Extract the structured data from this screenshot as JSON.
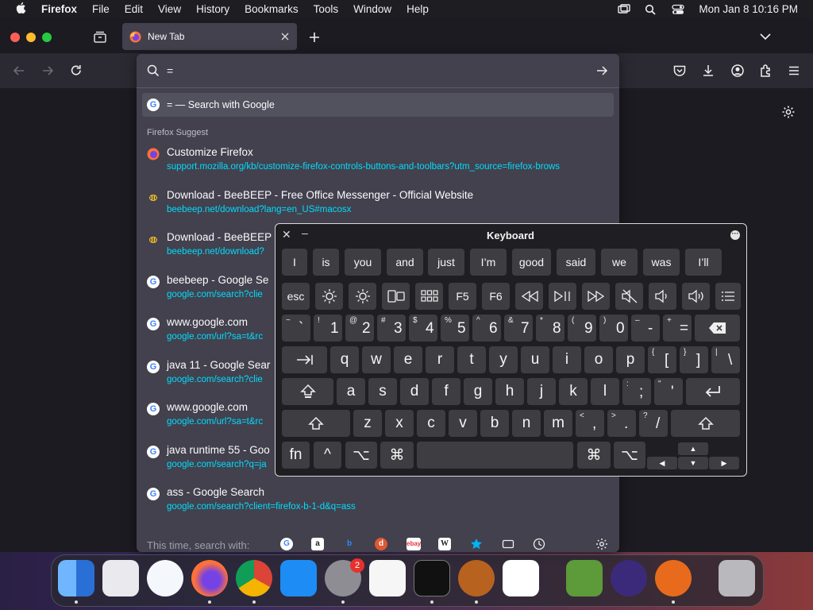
{
  "menubar": {
    "app": "Firefox",
    "items": [
      "File",
      "Edit",
      "View",
      "History",
      "Bookmarks",
      "Tools",
      "Window",
      "Help"
    ],
    "clock": "Mon Jan 8  10:16 PM"
  },
  "browser": {
    "tab_title": "New Tab",
    "url_value": "=",
    "google_search_label": "= — Search with Google",
    "suggest_header": "Firefox Suggest",
    "results": [
      {
        "title": "Customize Firefox",
        "url": "support.mozilla.org/kb/customize-firefox-controls-buttons-and-toolbars?utm_source=firefox-brows",
        "icon": "firefox-icon"
      },
      {
        "title": "Download - BeeBEEP - Free Office Messenger - Official Website",
        "url": "beebeep.net/download?lang=en_US#macosx",
        "icon": "bee-icon"
      },
      {
        "title": "Download - BeeBEEP",
        "url": "beebeep.net/download?",
        "icon": "bee-icon"
      },
      {
        "title": "beebeep - Google Se",
        "url": "google.com/search?clie",
        "icon": "google-icon"
      },
      {
        "title": "www.google.com",
        "url": "google.com/url?sa=t&rc",
        "icon": "google-icon"
      },
      {
        "title": "java 11 - Google Sear",
        "url": "google.com/search?clie",
        "icon": "google-icon"
      },
      {
        "title": "www.google.com",
        "url": "google.com/url?sa=t&rc",
        "icon": "google-icon"
      },
      {
        "title": "java runtime 55 - Goo",
        "url": "google.com/search?q=ja",
        "icon": "google-icon"
      },
      {
        "title": "ass - Google Search",
        "url": "google.com/search?client=firefox-b-1-d&q=ass",
        "icon": "google-icon"
      }
    ],
    "engines_label": "This time, search with:",
    "google_g": "G"
  },
  "keyboard": {
    "title": "Keyboard",
    "predictions": [
      "I",
      "is",
      "you",
      "and",
      "just",
      "I’m",
      "good",
      "said",
      "we",
      "was",
      "I’ll"
    ],
    "fn_row": [
      "esc",
      "F5",
      "F6"
    ],
    "num_row": [
      {
        "s": "~",
        "m": "`"
      },
      {
        "s": "!",
        "m": "1"
      },
      {
        "s": "@",
        "m": "2"
      },
      {
        "s": "#",
        "m": "3"
      },
      {
        "s": "$",
        "m": "4"
      },
      {
        "s": "%",
        "m": "5"
      },
      {
        "s": "^",
        "m": "6"
      },
      {
        "s": "&",
        "m": "7"
      },
      {
        "s": "*",
        "m": "8"
      },
      {
        "s": "(",
        "m": "9"
      },
      {
        "s": ")",
        "m": "0"
      },
      {
        "s": "–",
        "m": "-"
      },
      {
        "s": "+",
        "m": "="
      }
    ],
    "row_q": [
      "q",
      "w",
      "e",
      "r",
      "t",
      "y",
      "u",
      "i",
      "o",
      "p"
    ],
    "row_q_extra": [
      {
        "s": "{",
        "m": "["
      },
      {
        "s": "}",
        "m": "]"
      },
      {
        "s": "|",
        "m": "\\"
      }
    ],
    "row_a": [
      "a",
      "s",
      "d",
      "f",
      "g",
      "h",
      "j",
      "k",
      "l"
    ],
    "row_a_extra": [
      {
        "s": ":",
        "m": ";"
      },
      {
        "s": "\"",
        "m": "'"
      }
    ],
    "row_z": [
      "z",
      "x",
      "c",
      "v",
      "b",
      "n",
      "m"
    ],
    "row_z_extra": [
      {
        "s": "<",
        "m": ","
      },
      {
        "s": ">",
        "m": "."
      },
      {
        "s": "?",
        "m": "/"
      }
    ],
    "bottom": {
      "fn": "fn",
      "ctrl": "^",
      "opt": "⌥",
      "cmd": "⌘"
    }
  }
}
